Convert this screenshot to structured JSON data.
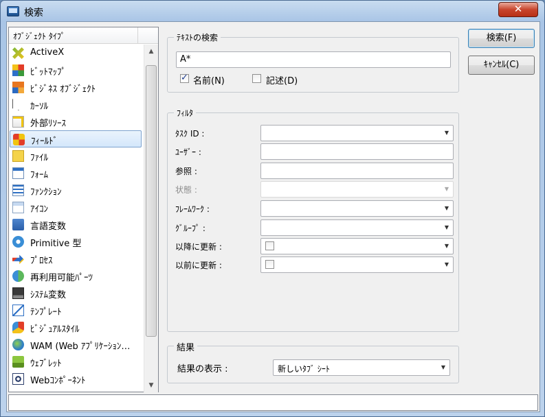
{
  "window": {
    "title": "検索",
    "close_label": "✕"
  },
  "list": {
    "header": "ｵﾌﾞｼﾞｪｸﾄ ﾀｲﾌﾟ",
    "items": [
      {
        "label": "ActiveX",
        "icon": "activex-icon"
      },
      {
        "label": "ﾋﾞｯﾄﾏｯﾌﾟ",
        "icon": "bitmap-icon"
      },
      {
        "label": "ﾋﾞｼﾞﾈｽ ｵﾌﾞｼﾞｪｸﾄ",
        "icon": "business-object-icon"
      },
      {
        "label": "ｶｰｿﾙ",
        "icon": "cursor-icon"
      },
      {
        "label": "外部ﾘｿｰｽ",
        "icon": "external-resource-icon"
      },
      {
        "label": "ﾌｨｰﾙﾄﾞ",
        "icon": "field-icon"
      },
      {
        "label": "ﾌｧｲﾙ",
        "icon": "file-icon"
      },
      {
        "label": "ﾌｫｰﾑ",
        "icon": "form-icon"
      },
      {
        "label": "ﾌｧﾝｸｼｮﾝ",
        "icon": "function-icon"
      },
      {
        "label": "ｱｲｺﾝ",
        "icon": "icon-icon"
      },
      {
        "label": "言語変数",
        "icon": "language-variable-icon"
      },
      {
        "label": "Primitive 型",
        "icon": "primitive-type-icon"
      },
      {
        "label": "ﾌﾟﾛｾｽ",
        "icon": "process-icon"
      },
      {
        "label": "再利用可能ﾊﾟｰﾂ",
        "icon": "reusable-parts-icon"
      },
      {
        "label": "ｼｽﾃﾑ変数",
        "icon": "system-variable-icon"
      },
      {
        "label": "ﾃﾝﾌﾟﾚｰﾄ",
        "icon": "template-icon"
      },
      {
        "label": "ﾋﾞｼﾞｭｱﾙｽﾀｲﾙ",
        "icon": "visual-style-icon"
      },
      {
        "label": "WAM (Web ｱﾌﾟﾘｹｰｼｮﾝ…",
        "icon": "wam-icon"
      },
      {
        "label": "ｳｪﾌﾞﾚｯﾄ",
        "icon": "weblet-icon"
      },
      {
        "label": "Webｺﾝﾎﾟｰﾈﾝﾄ",
        "icon": "web-component-icon"
      }
    ]
  },
  "text_search": {
    "group_label": "ﾃｷｽﾄの検索",
    "value": "A*",
    "name_label": "名前(N)",
    "name_checked": true,
    "desc_label": "記述(D)",
    "desc_checked": false
  },
  "filter": {
    "group_label": "ﾌｨﾙﾀ",
    "fields": [
      {
        "label": "ﾀｽｸ ID :",
        "type": "combo",
        "value": ""
      },
      {
        "label": "ﾕｰｻﾞｰ :",
        "type": "text",
        "value": ""
      },
      {
        "label": "参照 :",
        "type": "text",
        "value": ""
      },
      {
        "label": "状態 :",
        "type": "combo-disabled",
        "value": ""
      },
      {
        "label": "ﾌﾚｰﾑﾜｰｸ :",
        "type": "combo",
        "value": ""
      },
      {
        "label": "ｸﾞﾙｰﾌﾟ :",
        "type": "combo",
        "value": ""
      },
      {
        "label": "以降に更新 :",
        "type": "date",
        "value": ""
      },
      {
        "label": "以前に更新 :",
        "type": "date",
        "value": ""
      }
    ]
  },
  "results": {
    "group_label": "結果",
    "display_label": "結果の表示 :",
    "display_value": "新しいﾀﾌﾞ ｼｰﾄ"
  },
  "buttons": {
    "search": "検索(F)",
    "cancel": "ｷｬﾝｾﾙ(C)"
  },
  "status": {
    "text": ""
  }
}
